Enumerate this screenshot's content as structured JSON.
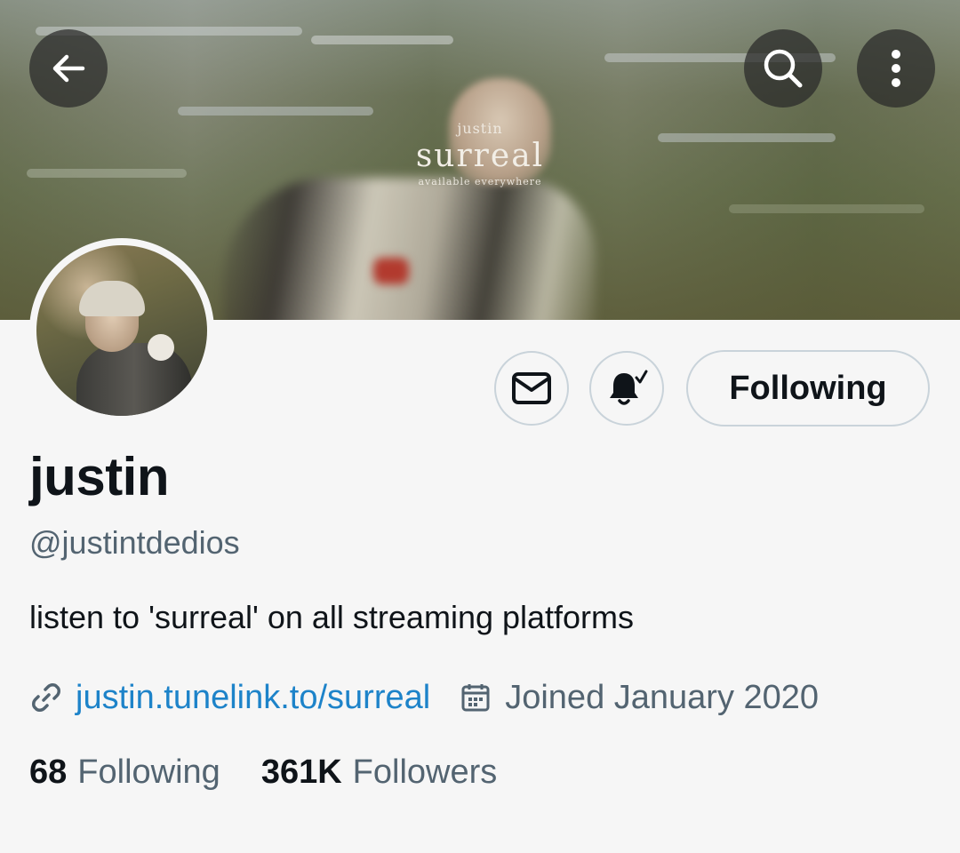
{
  "header": {
    "back_icon": "arrow-left-icon",
    "search_icon": "search-icon",
    "more_icon": "more-vertical-icon"
  },
  "banner": {
    "artist_text": "justin",
    "title_text": "surreal",
    "subtitle_text": "available everywhere"
  },
  "actions": {
    "message_icon": "envelope-icon",
    "notify_icon": "bell-check-icon",
    "follow_label": "Following"
  },
  "profile": {
    "name": "justin",
    "handle": "@justintdedios",
    "bio": "listen to 'surreal' on all streaming platforms",
    "link_text": "justin.tunelink.to/surreal",
    "joined_text": "Joined January 2020"
  },
  "stats": {
    "following_count": "68",
    "following_label": "Following",
    "followers_count": "361K",
    "followers_label": "Followers"
  },
  "colors": {
    "link": "#1d83c9",
    "muted": "#536471",
    "text": "#0f1419",
    "border": "#c9d3da"
  }
}
